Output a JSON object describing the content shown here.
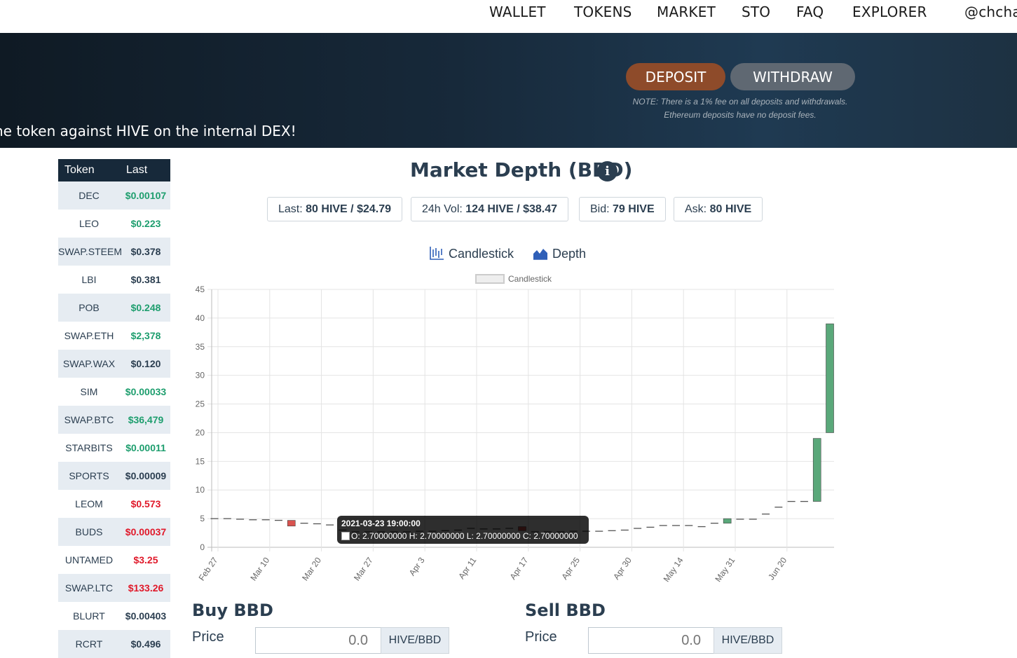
{
  "nav": {
    "items": [
      "WALLET",
      "TOKENS",
      "MARKET",
      "STO",
      "FAQ",
      "EXPLORER"
    ],
    "user": "@chchar"
  },
  "banner": {
    "tagline": "ne token against HIVE on the internal DEX!",
    "deposit_label": "DEPOSIT",
    "withdraw_label": "WITHDRAW",
    "note_line1": "NOTE: There is a 1% fee on all deposits and withdrawals.",
    "note_line2": "Ethereum deposits have no deposit fees."
  },
  "tokens": {
    "headers": [
      "Token",
      "Last"
    ],
    "rows": [
      {
        "symbol": "DEC",
        "price": "$0.00107",
        "color": "#1e9e6e"
      },
      {
        "symbol": "LEO",
        "price": "$0.223",
        "color": "#1e9e6e"
      },
      {
        "symbol": "SWAP.STEEM",
        "price": "$0.378",
        "color": "#2b3e50"
      },
      {
        "symbol": "LBI",
        "price": "$0.381",
        "color": "#2b3e50"
      },
      {
        "symbol": "POB",
        "price": "$0.248",
        "color": "#1e9e6e"
      },
      {
        "symbol": "SWAP.ETH",
        "price": "$2,378",
        "color": "#1e9e6e"
      },
      {
        "symbol": "SWAP.WAX",
        "price": "$0.120",
        "color": "#2b3e50"
      },
      {
        "symbol": "SIM",
        "price": "$0.00033",
        "color": "#1e9e6e"
      },
      {
        "symbol": "SWAP.BTC",
        "price": "$36,479",
        "color": "#1e9e6e"
      },
      {
        "symbol": "STARBITS",
        "price": "$0.00011",
        "color": "#1e9e6e"
      },
      {
        "symbol": "SPORTS",
        "price": "$0.00009",
        "color": "#2b3e50"
      },
      {
        "symbol": "LEOM",
        "price": "$0.573",
        "color": "#e0192a"
      },
      {
        "symbol": "BUDS",
        "price": "$0.00037",
        "color": "#e0192a"
      },
      {
        "symbol": "UNTAMED",
        "price": "$3.25",
        "color": "#e0192a"
      },
      {
        "symbol": "SWAP.LTC",
        "price": "$133.26",
        "color": "#e0192a"
      },
      {
        "symbol": "BLURT",
        "price": "$0.00403",
        "color": "#2b3e50"
      },
      {
        "symbol": "RCRT",
        "price": "$0.496",
        "color": "#2b3e50"
      }
    ]
  },
  "market": {
    "title": "Market Depth (BBD)",
    "stats": {
      "last_label": "Last:",
      "last_value": "80 HIVE / $24.79",
      "vol_label": "24h Vol:",
      "vol_value": "124 HIVE / $38.47",
      "bid_label": "Bid:",
      "bid_value": "79 HIVE",
      "ask_label": "Ask:",
      "ask_value": "80 HIVE"
    },
    "tabs": [
      "Candlestick",
      "Depth"
    ]
  },
  "tooltip": {
    "title": "2021-03-23 19:00:00",
    "body": "O: 2.70000000  H: 2.70000000  L: 2.70000000  C: 2.70000000"
  },
  "chart_data": {
    "type": "candlestick",
    "legend": "Candlestick",
    "ylim": [
      0,
      45
    ],
    "y_ticks": [
      0,
      5,
      10,
      15,
      20,
      25,
      30,
      35,
      40,
      45
    ],
    "x_tick_labels": [
      "Feb 27",
      "Mar 10",
      "Mar 20",
      "Mar 27",
      "Apr 3",
      "Apr 11",
      "Apr 17",
      "Apr 25",
      "Apr 30",
      "May 14",
      "May 31",
      "Jun 20"
    ],
    "colors": {
      "up": "#5aa87a",
      "down": "#d9534f",
      "flat": "#555555",
      "grid": "#e4e4e4"
    },
    "candles": [
      {
        "o": 5.0,
        "c": 5.0
      },
      {
        "o": 5.0,
        "c": 5.0
      },
      {
        "o": 4.9,
        "c": 4.9
      },
      {
        "o": 4.8,
        "c": 4.8
      },
      {
        "o": 4.8,
        "c": 4.8
      },
      {
        "o": 4.7,
        "c": 4.7
      },
      {
        "o": 4.7,
        "c": 3.7
      },
      {
        "o": 4.2,
        "c": 4.2
      },
      {
        "o": 4.1,
        "c": 4.1
      },
      {
        "o": 3.9,
        "c": 3.9
      },
      {
        "o": 3.0,
        "c": 3.0
      },
      {
        "o": 2.7,
        "c": 2.7
      },
      {
        "o": 2.7,
        "c": 2.7
      },
      {
        "o": 2.7,
        "c": 2.7
      },
      {
        "o": 2.7,
        "c": 2.7
      },
      {
        "o": 2.7,
        "c": 2.7
      },
      {
        "o": 2.8,
        "c": 2.8
      },
      {
        "o": 2.8,
        "c": 2.8
      },
      {
        "o": 2.9,
        "c": 2.9
      },
      {
        "o": 3.0,
        "c": 3.0
      },
      {
        "o": 3.3,
        "c": 3.3
      },
      {
        "o": 3.2,
        "c": 3.2
      },
      {
        "o": 3.2,
        "c": 3.2
      },
      {
        "o": 3.3,
        "c": 3.3
      },
      {
        "o": 3.6,
        "c": 2.9
      },
      {
        "o": 2.7,
        "c": 2.7
      },
      {
        "o": 2.7,
        "c": 2.7
      },
      {
        "o": 2.7,
        "c": 2.7
      },
      {
        "o": 2.8,
        "c": 2.8
      },
      {
        "o": 2.8,
        "c": 2.8
      },
      {
        "o": 2.8,
        "c": 2.8
      },
      {
        "o": 2.9,
        "c": 2.9
      },
      {
        "o": 3.0,
        "c": 3.0
      },
      {
        "o": 3.3,
        "c": 3.3
      },
      {
        "o": 3.5,
        "c": 3.5
      },
      {
        "o": 3.8,
        "c": 3.8
      },
      {
        "o": 3.8,
        "c": 3.8
      },
      {
        "o": 3.8,
        "c": 3.8
      },
      {
        "o": 3.6,
        "c": 3.6
      },
      {
        "o": 4.2,
        "c": 4.2
      },
      {
        "o": 4.2,
        "c": 5.0
      },
      {
        "o": 4.9,
        "c": 4.9
      },
      {
        "o": 4.9,
        "c": 4.9
      },
      {
        "o": 5.8,
        "c": 5.8
      },
      {
        "o": 7.0,
        "c": 7.0
      },
      {
        "o": 8.0,
        "c": 8.0
      },
      {
        "o": 8.0,
        "c": 8.0
      },
      {
        "o": 8.0,
        "c": 19.0
      },
      {
        "o": 20.0,
        "c": 39.0
      }
    ]
  },
  "buy": {
    "title": "Buy BBD",
    "price_label": "Price",
    "placeholder": "0.0",
    "unit": "HIVE/BBD"
  },
  "sell": {
    "title": "Sell BBD",
    "price_label": "Price",
    "placeholder": "0.0",
    "unit": "HIVE/BBD"
  }
}
